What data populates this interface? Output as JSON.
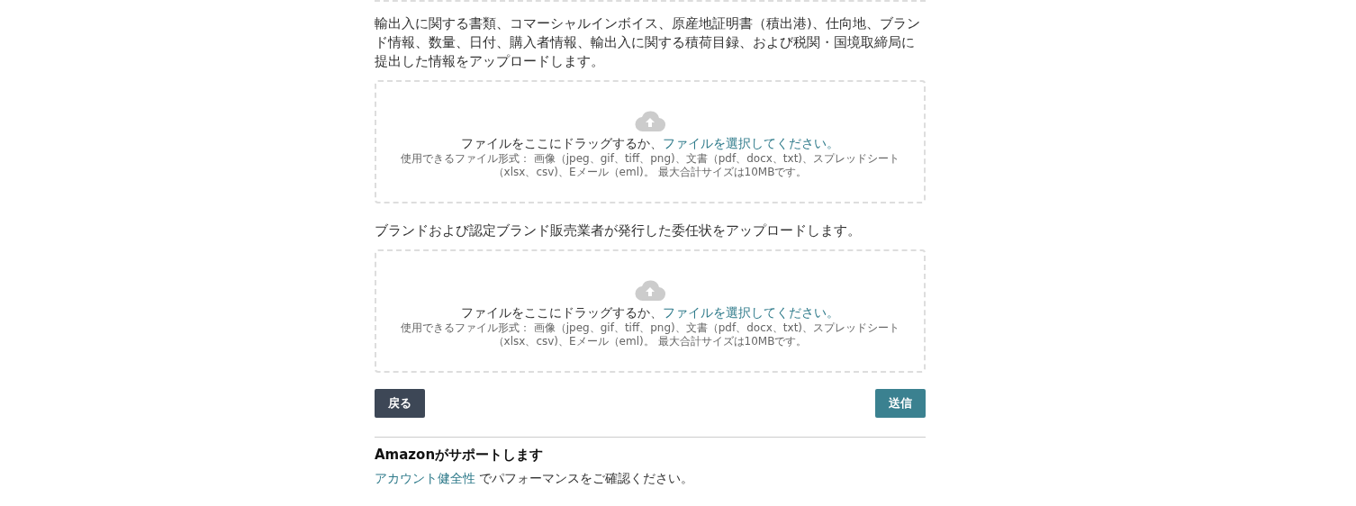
{
  "sections": [
    {
      "description": "輸出入に関する書類、コマーシャルインボイス、原産地証明書（積出港)、仕向地、ブランド情報、数量、日付、購入者情報、輸出入に関する積荷目録、および税関・国境取締局に提出した情報をアップロードします。",
      "dropzone": {
        "prompt": "ファイルをここにドラッグするか、",
        "link": "ファイルを選択してください。",
        "formats": "使用できるファイル形式： 画像（jpeg、gif、tiff、png)、文書（pdf、docx、txt)、スプレッドシート（xlsx、csv)、Eメール（eml)。 最大合計サイズは10MBです。"
      }
    },
    {
      "description": "ブランドおよび認定ブランド販売業者が発行した委任状をアップロードします。",
      "dropzone": {
        "prompt": "ファイルをここにドラッグするか、",
        "link": "ファイルを選択してください。",
        "formats": "使用できるファイル形式： 画像（jpeg、gif、tiff、png)、文書（pdf、docx、txt)、スプレッドシート（xlsx、csv)、Eメール（eml)。 最大合計サイズは10MBです。"
      }
    }
  ],
  "buttons": [
    {
      "label": "戻る",
      "kind": "secondary"
    },
    {
      "label": "送信",
      "kind": "primary"
    }
  ],
  "support": {
    "title": "Amazonがサポートします",
    "link": "アカウント健全性",
    "text": " でパフォーマンスをご確認ください。"
  }
}
